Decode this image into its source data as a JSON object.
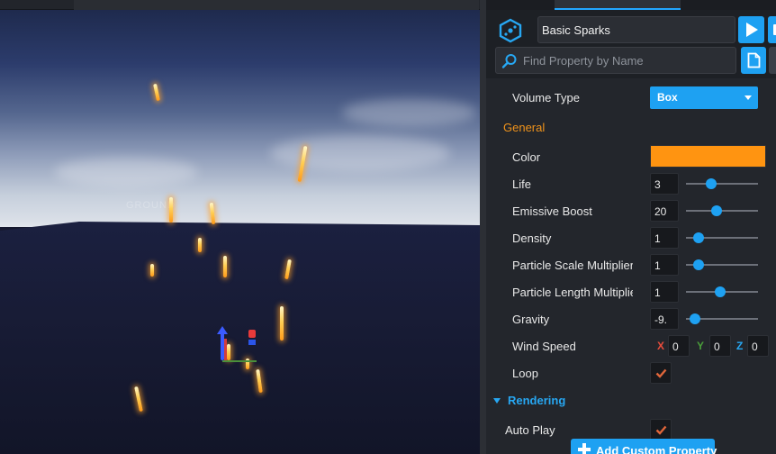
{
  "viewport": {
    "ground_label": "GROUND"
  },
  "panel": {
    "object_name": "Basic Sparks",
    "search": {
      "placeholder": "Find Property by Name"
    }
  },
  "properties": {
    "volume_type": {
      "label": "Volume Type",
      "value": "Box"
    },
    "general_header": "General",
    "color": {
      "label": "Color",
      "value": "#FF9411"
    },
    "life": {
      "label": "Life",
      "value": "3",
      "slider_fraction": 0.35
    },
    "emissive_boost": {
      "label": "Emissive Boost",
      "value": "20",
      "slider_fraction": 0.43
    },
    "density": {
      "label": "Density",
      "value": "1",
      "slider_fraction": 0.18
    },
    "particle_scale_multiplier": {
      "label": "Particle Scale Multiplier",
      "value": "1",
      "slider_fraction": 0.18
    },
    "particle_length_multiplier": {
      "label": "Particle Length Multiplier",
      "value": "1",
      "slider_fraction": 0.47
    },
    "gravity": {
      "label": "Gravity",
      "value": "-9.",
      "slider_fraction": 0.12
    },
    "wind_speed": {
      "label": "Wind Speed",
      "x_label": "X",
      "x": "0",
      "y_label": "Y",
      "y": "0",
      "z_label": "Z",
      "z": "0"
    },
    "loop": {
      "label": "Loop",
      "checked": true
    },
    "rendering_header": "Rendering",
    "auto_play": {
      "label": "Auto Play",
      "checked": true
    }
  },
  "buttons": {
    "add_custom_property": "Add Custom Property"
  },
  "colors": {
    "accent": "#1EA1F2",
    "section_general": "#F0931B",
    "check": "#E0663A",
    "axis_x": "#E74C3C",
    "axis_y": "#4A9F3A",
    "axis_z": "#27A7F2"
  }
}
